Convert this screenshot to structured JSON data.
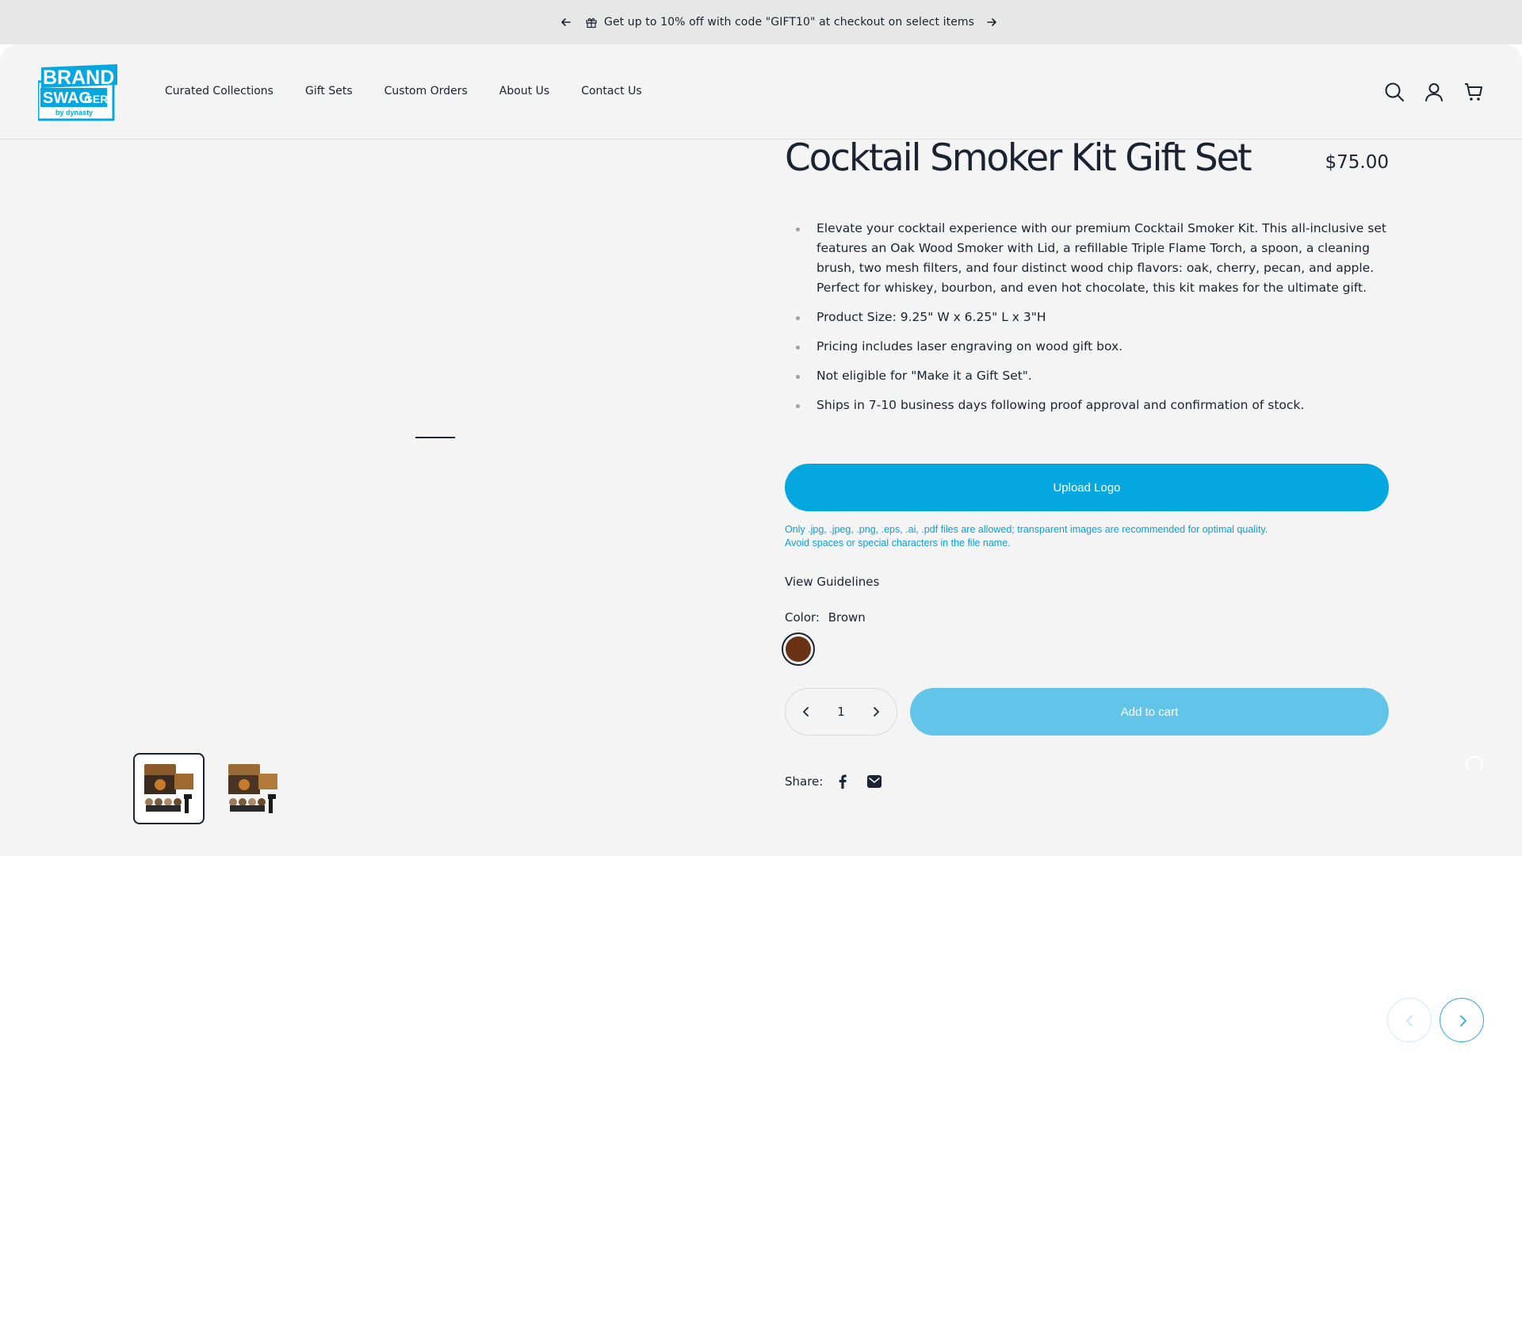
{
  "announcement": {
    "text": "Get up to 10% off with code \"GIFT10\" at checkout on select items"
  },
  "header": {
    "logo": {
      "line1": "BRAND",
      "line2": "SWAG",
      "line2b": "GER",
      "line3": "by dynasty"
    },
    "nav": [
      "Curated Collections",
      "Gift Sets",
      "Custom Orders",
      "About Us",
      "Contact Us"
    ],
    "icons": [
      "search-icon",
      "account-icon",
      "cart-icon"
    ]
  },
  "product": {
    "title": "Cocktail Smoker Kit Gift Set",
    "price": "$75.00",
    "description": [
      "Elevate your cocktail experience with our premium Cocktail Smoker Kit. This all-inclusive set features an Oak Wood Smoker with Lid, a refillable Triple Flame Torch, a spoon, a cleaning brush, two mesh filters, and four distinct wood chip flavors: oak, cherry, pecan, and apple. Perfect for whiskey, bourbon, and even hot chocolate, this kit makes for the ultimate gift.",
      "Product Size: 9.25\" W x 6.25\" L x 3\"H",
      "Pricing includes laser engraving on wood gift box.",
      "Not eligible for \"Make it a Gift Set\".",
      "Ships in 7-10 business days following proof approval and confirmation of stock."
    ],
    "upload_label": "Upload Logo",
    "upload_note_1": "Only .jpg, .jpeg, .png, .eps, .ai, .pdf files are allowed; transparent images are recommended for optimal quality.",
    "upload_note_2": "Avoid spaces or special characters in the file name.",
    "guidelines_label": "View Guidelines",
    "color_label": "Color:",
    "color_value": "Brown",
    "swatch_color": "#6b3316",
    "quantity": "1",
    "add_to_cart_label": "Add to cart",
    "share_label": "Share:"
  },
  "colors": {
    "accent": "#04a7e0",
    "accent_light": "#62c4e8",
    "text": "#1a2332",
    "panel_bg": "#f4f4f4",
    "announce_bg": "#e7e7e7"
  }
}
